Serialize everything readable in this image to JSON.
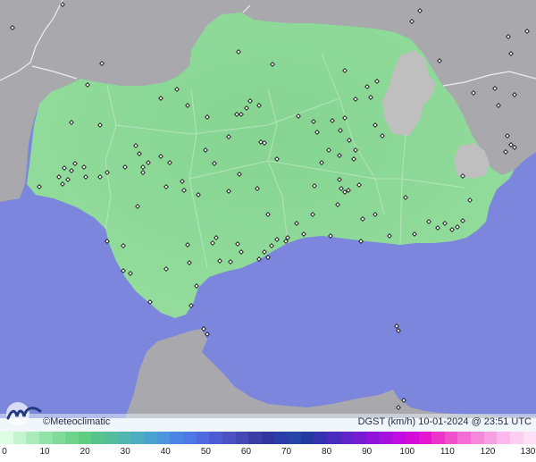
{
  "map": {
    "credit_symbol": "©",
    "credit": "Meteoclimatic",
    "parameter": "DGST (km/h)",
    "timestamp": "10-01-2024 @ 23:51 UTC",
    "colors": {
      "sea": "#7b86dc",
      "foreign_land": "#a9a9ad",
      "land": "#8fd99a",
      "high_ground": "#bfbfbf",
      "station_marker": "#000000"
    }
  },
  "legend": {
    "labels": [
      "0",
      "10",
      "20",
      "30",
      "40",
      "50",
      "60",
      "70",
      "80",
      "90",
      "100",
      "110",
      "120",
      "130"
    ],
    "colors": [
      "#dcfce4",
      "#c3f4cf",
      "#a9ecba",
      "#91e4a8",
      "#7fdc98",
      "#6ed48a",
      "#60cc82",
      "#57c48c",
      "#55bd9c",
      "#52b5ae",
      "#4eadc0",
      "#4aa2d0",
      "#4a95dc",
      "#4b86e4",
      "#4d78e6",
      "#4f6ae0",
      "#4f5dd4",
      "#4c52c4",
      "#4548b4",
      "#3a3ea4",
      "#3035a0",
      "#2a3da8",
      "#2544a8",
      "#2438a0",
      "#3434b0",
      "#4a2cbc",
      "#6024c8",
      "#781cd4",
      "#9014dc",
      "#a810e0",
      "#c00ce0",
      "#d40cd8",
      "#e418cc",
      "#ec34c8",
      "#f050cc",
      "#f46cd4",
      "#f688dc",
      "#f8a0e4",
      "#fab8ec",
      "#fccff2",
      "#fde0f6"
    ]
  }
}
